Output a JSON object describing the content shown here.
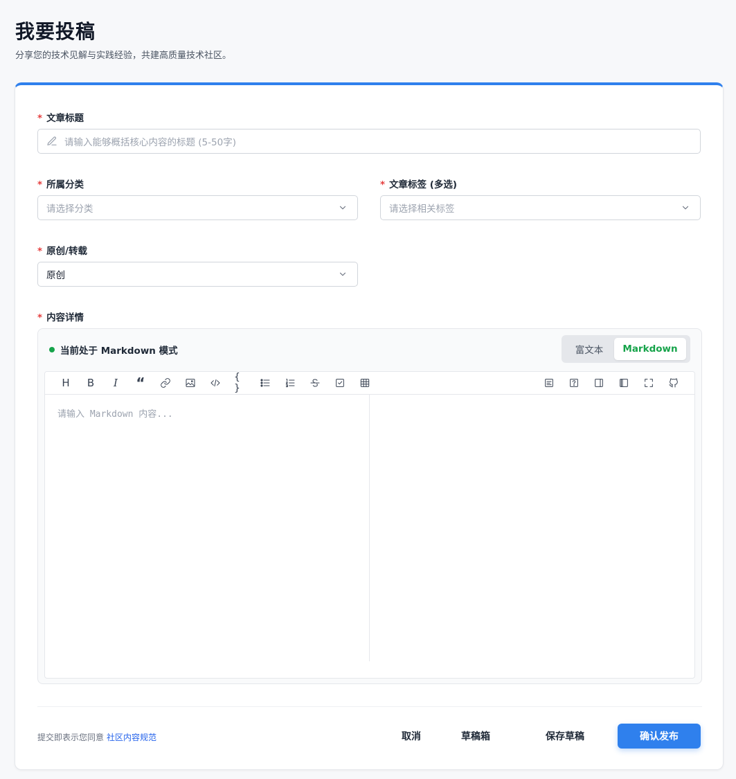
{
  "header": {
    "title": "我要投稿",
    "subtitle": "分享您的技术见解与实践经验，共建高质量技术社区。"
  },
  "form": {
    "required_mark": "*",
    "title_field": {
      "label": "文章标题",
      "placeholder": "请输入能够概括核心内容的标题 (5-50字)"
    },
    "category_field": {
      "label": "所属分类",
      "placeholder": "请选择分类"
    },
    "tags_field": {
      "label": "文章标签 (多选)",
      "placeholder": "请选择相关标签"
    },
    "origin_field": {
      "label": "原创/转载",
      "value": "原创"
    },
    "content_field": {
      "label": "内容详情"
    }
  },
  "editor": {
    "mode_text": "当前处于 Markdown 模式",
    "toggle": {
      "rich_label": "富文本",
      "markdown_label": "Markdown",
      "active": "Markdown"
    },
    "placeholder": "请输入 Markdown 内容...",
    "toolbar_left": [
      "heading-icon",
      "bold-icon",
      "italic-icon",
      "quote-icon",
      "link-icon",
      "image-icon",
      "code-icon",
      "code-block-icon",
      "unordered-list-icon",
      "ordered-list-icon",
      "strikethrough-icon",
      "task-list-icon",
      "table-icon"
    ],
    "toolbar_right": [
      "catalog-icon",
      "help-icon",
      "preview-only-icon",
      "editor-preview-icon",
      "fullscreen-icon",
      "github-icon"
    ],
    "toolbar_glyphs": {
      "heading": "H",
      "bold": "B",
      "italic": "I",
      "quote": "“",
      "code_block": "{ }"
    }
  },
  "footer": {
    "agreement_prefix": "提交即表示您同意",
    "agreement_link": "社区内容规范",
    "cancel_label": "取消",
    "drafts_label": "草稿箱",
    "save_draft_label": "保存草稿",
    "publish_label": "确认发布"
  },
  "colors": {
    "accent": "#2f80ed",
    "required": "#e53e3e",
    "markdown_active": "#16a34a",
    "link": "#2563eb"
  }
}
